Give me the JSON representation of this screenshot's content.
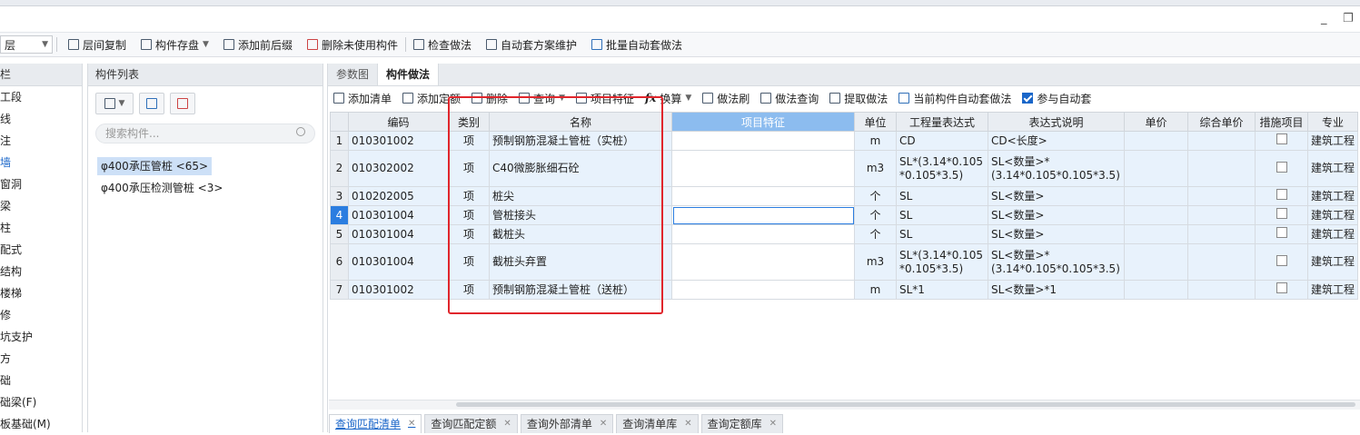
{
  "window": {
    "minimize": "_",
    "restore": "❐"
  },
  "toolbar1": {
    "floor_value": "层",
    "buttons": [
      "层间复制",
      "构件存盘",
      "添加前后缀",
      "删除未使用构件",
      "检查做法",
      "自动套方案维护",
      "批量自动套做法"
    ]
  },
  "nav": {
    "header": "栏",
    "items": [
      "工段",
      "线",
      "注",
      "墙",
      "窗洞",
      "梁",
      "柱",
      "配式",
      "结构",
      "楼梯",
      "修",
      "坑支护",
      "方",
      "础",
      "础梁(F)",
      "板基础(M)"
    ]
  },
  "component_list": {
    "header": "构件列表",
    "search_placeholder": "搜索构件...",
    "items": [
      "φ400承压管桩 <65>",
      "φ400承压检测管桩 <3>"
    ]
  },
  "main": {
    "tabs": [
      "参数图",
      "构件做法"
    ],
    "toolbar": [
      "添加清单",
      "添加定额",
      "删除",
      "查询",
      "项目特征",
      "换算",
      "做法刷",
      "做法查询",
      "提取做法",
      "当前构件自动套做法",
      "参与自动套"
    ],
    "columns": [
      "编码",
      "类别",
      "名称",
      "项目特征",
      "单位",
      "工程量表达式",
      "表达式说明",
      "单价",
      "综合单价",
      "措施项目",
      "专业"
    ],
    "rows": [
      {
        "no": "1",
        "code": "010301002",
        "type": "项",
        "name": "预制钢筋混凝土管桩（实桩）",
        "feature": "",
        "unit": "m",
        "expr": "CD",
        "desc": "CD<长度>",
        "price": "",
        "total": "",
        "measure": false,
        "major": "建筑工程"
      },
      {
        "no": "2",
        "code": "010302002",
        "type": "项",
        "name": "C40微膨胀细石砼",
        "feature": "",
        "unit": "m3",
        "expr": "SL*(3.14*0.105*0.105*3.5)",
        "desc": "SL<数量>*(3.14*0.105*0.105*3.5)",
        "price": "",
        "total": "",
        "measure": false,
        "major": "建筑工程"
      },
      {
        "no": "3",
        "code": "010202005",
        "type": "项",
        "name": "桩尖",
        "feature": "",
        "unit": "个",
        "expr": "SL",
        "desc": "SL<数量>",
        "price": "",
        "total": "",
        "measure": false,
        "major": "建筑工程"
      },
      {
        "no": "4",
        "code": "010301004",
        "type": "项",
        "name": "管桩接头",
        "feature": "",
        "unit": "个",
        "expr": "SL",
        "desc": "SL<数量>",
        "price": "",
        "total": "",
        "measure": false,
        "major": "建筑工程"
      },
      {
        "no": "5",
        "code": "010301004",
        "type": "项",
        "name": "截桩头",
        "feature": "",
        "unit": "个",
        "expr": "SL",
        "desc": "SL<数量>",
        "price": "",
        "total": "",
        "measure": false,
        "major": "建筑工程"
      },
      {
        "no": "6",
        "code": "010301004",
        "type": "项",
        "name": "截桩头弃置",
        "feature": "",
        "unit": "m3",
        "expr": "SL*(3.14*0.105*0.105*3.5)",
        "desc": "SL<数量>*(3.14*0.105*0.105*3.5)",
        "price": "",
        "total": "",
        "measure": false,
        "major": "建筑工程"
      },
      {
        "no": "7",
        "code": "010301002",
        "type": "项",
        "name": "预制钢筋混凝土管桩（送桩）",
        "feature": "",
        "unit": "m",
        "expr": "SL*1",
        "desc": "SL<数量>*1",
        "price": "",
        "total": "",
        "measure": false,
        "major": "建筑工程"
      }
    ]
  },
  "bottom_tabs": [
    "查询匹配清单",
    "查询匹配定额",
    "查询外部清单",
    "查询清单库",
    "查询定额库"
  ],
  "colors": {
    "accent": "#1a66c9",
    "highlight_box": "#e0262c",
    "row_bg": "#e8f2fc"
  }
}
